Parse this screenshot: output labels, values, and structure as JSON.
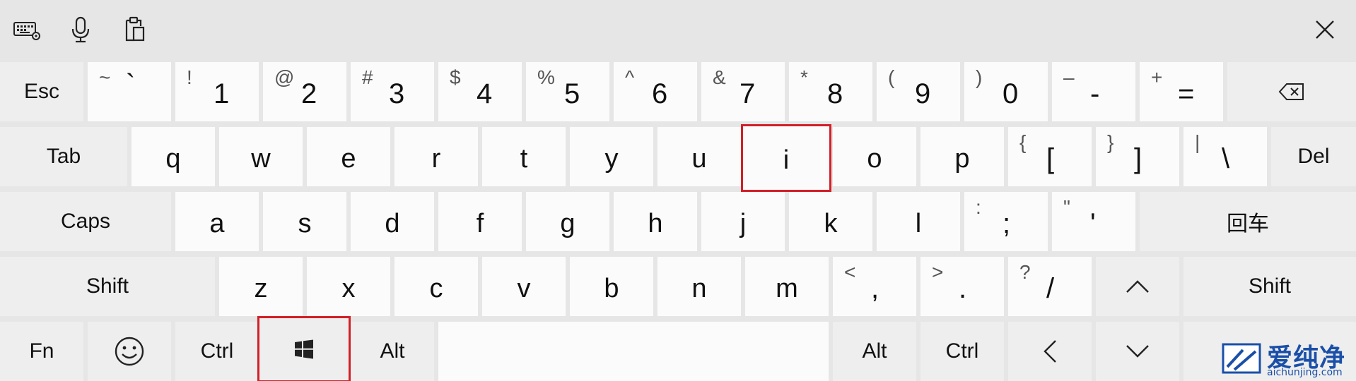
{
  "toolbar": {
    "icons": [
      "keyboard-settings-icon",
      "microphone-icon",
      "clipboard-icon",
      "close-icon"
    ]
  },
  "rows": {
    "numbers": [
      {
        "main": "Esc"
      },
      {
        "shift": "~",
        "main": "`"
      },
      {
        "shift": "!",
        "main": "1"
      },
      {
        "shift": "@",
        "main": "2"
      },
      {
        "shift": "#",
        "main": "3"
      },
      {
        "shift": "$",
        "main": "4"
      },
      {
        "shift": "%",
        "main": "5"
      },
      {
        "shift": "^",
        "main": "6"
      },
      {
        "shift": "&",
        "main": "7"
      },
      {
        "shift": "*",
        "main": "8"
      },
      {
        "shift": "(",
        "main": "9"
      },
      {
        "shift": ")",
        "main": "0"
      },
      {
        "shift": "–",
        "main": "-"
      },
      {
        "shift": "+",
        "main": "="
      },
      {
        "icon": "backspace-icon"
      }
    ],
    "qwerty": [
      {
        "main": "Tab"
      },
      {
        "main": "q"
      },
      {
        "main": "w"
      },
      {
        "main": "e"
      },
      {
        "main": "r"
      },
      {
        "main": "t"
      },
      {
        "main": "y"
      },
      {
        "main": "u"
      },
      {
        "main": "i"
      },
      {
        "main": "o"
      },
      {
        "main": "p"
      },
      {
        "shift": "{",
        "main": "["
      },
      {
        "shift": "}",
        "main": "]"
      },
      {
        "shift": "|",
        "main": "\\"
      },
      {
        "main": "Del"
      }
    ],
    "home": [
      {
        "main": "Caps"
      },
      {
        "main": "a"
      },
      {
        "main": "s"
      },
      {
        "main": "d"
      },
      {
        "main": "f"
      },
      {
        "main": "g"
      },
      {
        "main": "h"
      },
      {
        "main": "j"
      },
      {
        "main": "k"
      },
      {
        "main": "l"
      },
      {
        "shift": ":",
        "main": ";"
      },
      {
        "shift": "\"",
        "main": "'"
      },
      {
        "main": "回车"
      }
    ],
    "bottom": [
      {
        "main": "Shift"
      },
      {
        "main": "z"
      },
      {
        "main": "x"
      },
      {
        "main": "c"
      },
      {
        "main": "v"
      },
      {
        "main": "b"
      },
      {
        "main": "n"
      },
      {
        "main": "m"
      },
      {
        "shift": "<",
        "main": ","
      },
      {
        "shift": ">",
        "main": "."
      },
      {
        "shift": "?",
        "main": "/"
      },
      {
        "icon": "arrow-up-icon"
      },
      {
        "main": "Shift"
      }
    ],
    "space": [
      {
        "main": "Fn"
      },
      {
        "icon": "emoji-icon"
      },
      {
        "main": "Ctrl"
      },
      {
        "icon": "windows-logo-icon"
      },
      {
        "main": "Alt"
      },
      {
        "main": ""
      },
      {
        "main": "Alt"
      },
      {
        "main": "Ctrl"
      },
      {
        "icon": "arrow-left-icon"
      },
      {
        "icon": "arrow-down-icon"
      }
    ]
  },
  "highlighted_keys": [
    "i",
    "windows"
  ],
  "colors": {
    "highlight": "#d21f26",
    "key": "#fbfbfb",
    "func_key": "#eeeeee",
    "background": "#e6e6e6",
    "watermark": "#1a4fa8"
  },
  "watermark": {
    "cn": "爱纯净",
    "en": "aichunjing.com"
  }
}
